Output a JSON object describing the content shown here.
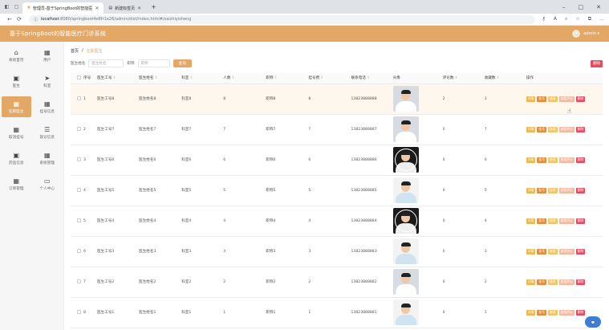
{
  "browser": {
    "tabs": [
      {
        "title": "管理员-基于SpringBoot的智能医",
        "active": true
      },
      {
        "title": "新建标签页",
        "active": false
      }
    ],
    "address": {
      "host": "localhost",
      "path": ":8080/springboot4e8fr1e26/admin/dist/index.html#/zaizhiyisheng"
    },
    "window_controls": [
      "–",
      "□",
      "✕"
    ]
  },
  "header": {
    "title": "基于SpringBoot的智能医疗门诊系统",
    "user_label": "admin ▾"
  },
  "sidebar": {
    "items": [
      {
        "label": "系统首页",
        "icon": "home-icon",
        "glyph": "⌂",
        "active": false
      },
      {
        "label": "用户",
        "icon": "grid-icon",
        "glyph": "▦",
        "active": false
      },
      {
        "label": "医生",
        "icon": "monitor-icon",
        "glyph": "▣",
        "active": false
      },
      {
        "label": "科室",
        "icon": "send-icon",
        "glyph": "➤",
        "active": false
      },
      {
        "label": "在职医生",
        "icon": "grid-icon",
        "glyph": "▦",
        "active": true
      },
      {
        "label": "挂号信息",
        "icon": "grid-icon",
        "glyph": "▦",
        "active": false
      },
      {
        "label": "取消挂号",
        "icon": "grid-icon",
        "glyph": "▦",
        "active": false
      },
      {
        "label": "就诊信息",
        "icon": "list-icon",
        "glyph": "☰",
        "active": false
      },
      {
        "label": "药品信息",
        "icon": "monitor-icon",
        "glyph": "▣",
        "active": false
      },
      {
        "label": "系统管理",
        "icon": "grid-icon",
        "glyph": "▦",
        "active": false
      },
      {
        "label": "订单管理",
        "icon": "grid-icon",
        "glyph": "▦",
        "active": false
      },
      {
        "label": "个人中心",
        "icon": "card-icon",
        "glyph": "▭",
        "active": false
      }
    ]
  },
  "breadcrumb": {
    "home": "首页",
    "sep": "/",
    "current": "在职医生"
  },
  "search": {
    "label1": "医生姓名",
    "placeholder1": "医生姓名",
    "label2": "职称",
    "placeholder2": "职称",
    "button": "查询",
    "delete_button": "删除"
  },
  "table": {
    "columns": [
      "序号",
      "医生工号",
      "医生姓名",
      "科室",
      "人数",
      "职称",
      "挂号费",
      "联系电话",
      "头像",
      "评论数",
      "收藏数",
      "操作"
    ],
    "rows": [
      {
        "no": "1",
        "id": "医生工号8",
        "name": "医生姓名8",
        "dept": "科室8",
        "count": "8",
        "title": "职称8",
        "fee": "8",
        "phone": "13823888888",
        "photo": "light",
        "comments": "2",
        "favorites": "3",
        "hl": true
      },
      {
        "no": "2",
        "id": "医生工号7",
        "name": "医生姓名7",
        "dept": "科室7",
        "count": "7",
        "title": "职称7",
        "fee": "7",
        "phone": "13823888887",
        "photo": "light",
        "comments": "0",
        "favorites": "7",
        "hl": false
      },
      {
        "no": "3",
        "id": "医生工号6",
        "name": "医生姓名6",
        "dept": "科室6",
        "count": "6",
        "title": "职称6",
        "fee": "6",
        "phone": "13823888886",
        "photo": "dark",
        "comments": "0",
        "favorites": "6",
        "hl": false
      },
      {
        "no": "4",
        "id": "医生工号5",
        "name": "医生姓名5",
        "dept": "科室5",
        "count": "5",
        "title": "职称5",
        "fee": "5",
        "phone": "13823888885",
        "photo": "white",
        "comments": "0",
        "favorites": "5",
        "hl": false
      },
      {
        "no": "5",
        "id": "医生工号4",
        "name": "医生姓名4",
        "dept": "科室4",
        "count": "4",
        "title": "职称4",
        "fee": "4",
        "phone": "13823888884",
        "photo": "dark",
        "comments": "0",
        "favorites": "4",
        "hl": false
      },
      {
        "no": "6",
        "id": "医生工号3",
        "name": "医生姓名3",
        "dept": "科室3",
        "count": "3",
        "title": "职称3",
        "fee": "3",
        "phone": "13823888883",
        "photo": "white",
        "comments": "0",
        "favorites": "3",
        "hl": false
      },
      {
        "no": "7",
        "id": "医生工号2",
        "name": "医生姓名2",
        "dept": "科室2",
        "count": "2",
        "title": "职称2",
        "fee": "2",
        "phone": "13823888882",
        "photo": "light",
        "comments": "0",
        "favorites": "2",
        "hl": false
      },
      {
        "no": "8",
        "id": "医生工号1",
        "name": "医生姓名1",
        "dept": "科室1",
        "count": "1",
        "title": "职称1",
        "fee": "1",
        "phone": "13823888881",
        "photo": "white",
        "comments": "0",
        "favorites": "1",
        "hl": false
      }
    ],
    "ops": [
      "详情",
      "挂号",
      "修改",
      "查看评论",
      "删除"
    ]
  },
  "colors": {
    "accent": "#e3a865",
    "danger": "#e84a5f"
  }
}
